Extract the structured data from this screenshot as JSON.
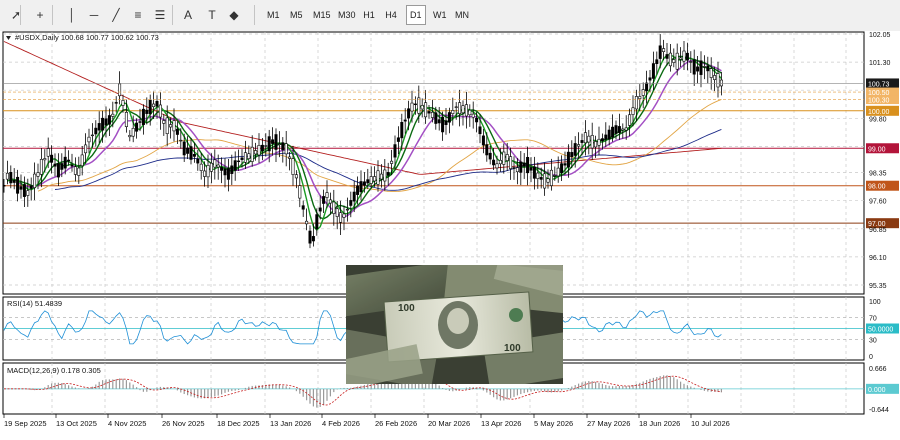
{
  "toolbar": {
    "icons": [
      {
        "name": "cursor-arrow-icon",
        "glyph": "➚"
      },
      {
        "name": "crosshair-icon",
        "glyph": "+"
      },
      {
        "name": "vertical-line-icon",
        "glyph": "│"
      },
      {
        "name": "horizontal-line-icon",
        "glyph": "─"
      },
      {
        "name": "trendline-icon",
        "glyph": "╱"
      },
      {
        "name": "equidistant-channel-icon",
        "glyph": "≡"
      },
      {
        "name": "fibonacci-retracement-icon",
        "glyph": "☰"
      },
      {
        "name": "text-label-icon",
        "glyph": "A"
      },
      {
        "name": "text-box-icon",
        "glyph": "T"
      },
      {
        "name": "shapes-menu-icon",
        "glyph": "◆"
      }
    ],
    "timeframes": [
      "M1",
      "M5",
      "M15",
      "M30",
      "H1",
      "H4",
      "D1",
      "W1",
      "MN"
    ],
    "active_timeframe": "D1"
  },
  "symbol_header": {
    "label": "#USDX,Daily  100.68 100.77 100.62 100.73"
  },
  "price_axis": {
    "ticks": [
      "102.05",
      "101.30",
      "100.73",
      "100.50",
      "100.30",
      "100.00",
      "99.80",
      "99.00",
      "98.35",
      "98.00",
      "97.60",
      "97.00",
      "96.85",
      "96.10",
      "95.35"
    ],
    "current": "100.73"
  },
  "horizontal_levels": [
    {
      "value": 100.0,
      "label": "100.00",
      "color": "#d9901d"
    },
    {
      "value": 99.0,
      "label": "99.00",
      "color": "#b3143a"
    },
    {
      "value": 98.0,
      "label": "98.00",
      "color": "#c0551a"
    },
    {
      "value": 97.0,
      "label": "97.00",
      "color": "#8a3a12"
    }
  ],
  "rsi": {
    "label": "RSI(14) 51.4839",
    "ticks": [
      "100",
      "70",
      "50.0000",
      "30",
      "0"
    ],
    "line_color": "#1e8fd6",
    "level_color": "#2bbcc7"
  },
  "macd": {
    "label": "MACD(12,26,9) 0.178 0.305",
    "ticks": [
      "0.666",
      "0.000",
      "-0.644"
    ],
    "histogram_color": "#9a9a9a",
    "signal_color": "#c81e1e"
  },
  "date_axis": {
    "labels": [
      "19 Sep 2025",
      "13 Oct 2025",
      "4 Nov 2025",
      "26 Nov 2025",
      "18 Dec 2025",
      "13 Jan 2026",
      "4 Feb 2026",
      "26 Feb 2026",
      "20 Mar 2026",
      "13 Apr 2026",
      "5 May 2026",
      "27 May 2026",
      "18 Jun 2026",
      "10 Jul 2026"
    ]
  },
  "colors": {
    "candle": "#000000",
    "grid": "#c9c9c9",
    "ma_green": "#1a9a22",
    "ma_dark_green": "#0b6b12",
    "ma_violet": "#a34fc4",
    "ma_orange": "#e2a545",
    "ma_navy": "#1f2d8a",
    "ma_red": "#b31f1f",
    "accent_price_box": "#1a1a1a"
  },
  "image": {
    "description_name": "us-dollar-banknotes-photo"
  }
}
